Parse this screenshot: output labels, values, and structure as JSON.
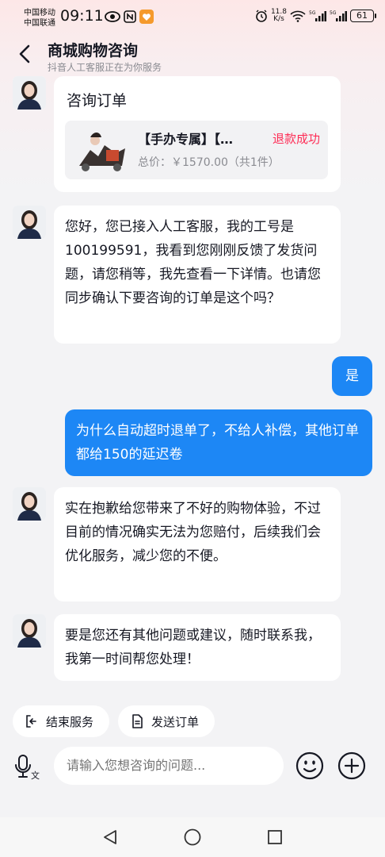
{
  "status_bar": {
    "carrier_1": "中国移动",
    "carrier_2": "中国联通",
    "time": "09:11",
    "net_speed_value": "11.8",
    "net_speed_unit": "K/s",
    "battery": "61"
  },
  "header": {
    "title": "商城购物咨询",
    "subtitle": "抖音人工客服正在为你服务"
  },
  "order_card": {
    "title": "咨询订单",
    "product_name": "【手办专属】【…",
    "status": "退款成功",
    "price": "总价：￥1570.00（共1件）"
  },
  "messages": [
    {
      "side": "left",
      "text": "您好，您已接入人工客服，我的工号是100199591，我看到您刚刚反馈了发货问题，请您稍等，我先查看一下详情。也请您同步确认下要咨询的订单是这个吗？"
    },
    {
      "side": "right",
      "text": "是"
    },
    {
      "side": "right",
      "text": "为什么自动超时退单了，不给人补偿，其他订单都给150的延迟卷"
    },
    {
      "side": "left",
      "text": "实在抱歉给您带来了不好的购物体验，不过目前的情况确实无法为您赔付，后续我们会优化服务，减少您的不便。"
    },
    {
      "side": "left",
      "text": "要是您还有其他问题或建议，随时联系我，我第一时间帮您处理！"
    }
  ],
  "quick_actions": {
    "end_service": "结束服务",
    "send_order": "发送订单"
  },
  "input": {
    "placeholder": "请输入您想咨询的问题..."
  },
  "colors": {
    "accent_blue": "#1d87f5",
    "status_red": "#fe2c55"
  }
}
